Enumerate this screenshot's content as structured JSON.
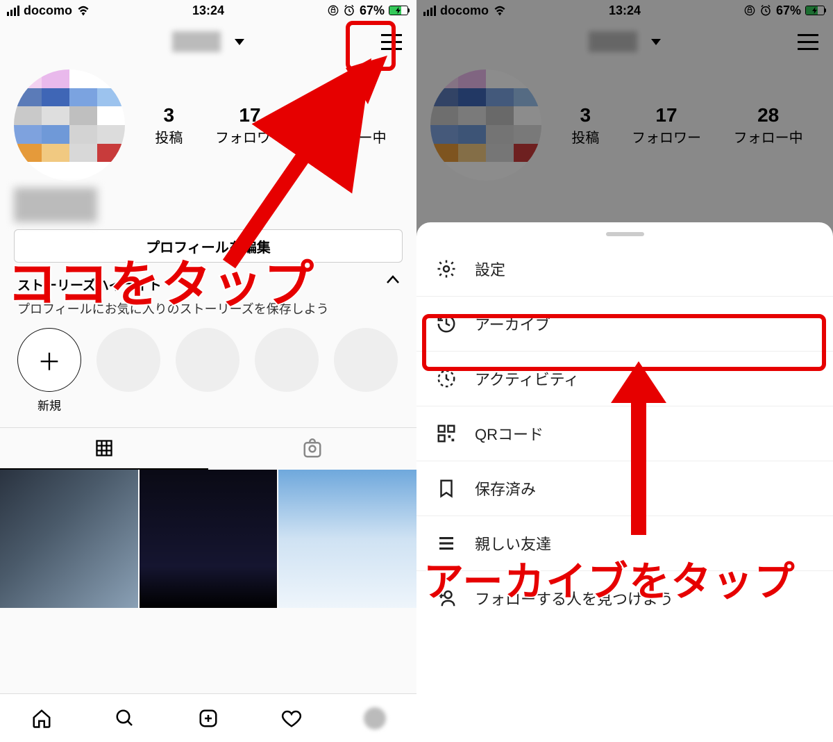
{
  "status": {
    "carrier": "docomo",
    "time": "13:24",
    "battery_pct": "67%"
  },
  "nav": {
    "chevron": "▾"
  },
  "stats": {
    "posts": {
      "count": "3",
      "label": "投稿"
    },
    "followers": {
      "count": "17",
      "label": "フォロワー"
    },
    "following": {
      "count": "28",
      "label": "フォロー中"
    }
  },
  "edit_profile": "プロフィールを編集",
  "highlights": {
    "title": "ストーリーズハイライト",
    "desc": "プロフィールにお気に入りのストーリーズを保存しよう",
    "new_label": "新規"
  },
  "menu": {
    "settings": "設定",
    "archive": "アーカイブ",
    "activity": "アクティビティ",
    "qr": "QRコード",
    "saved": "保存済み",
    "close_friends": "親しい友達",
    "discover": "フォローする人を見つけよう"
  },
  "callout": {
    "left": "ココをタップ",
    "right": "アーカイブをタップ"
  }
}
